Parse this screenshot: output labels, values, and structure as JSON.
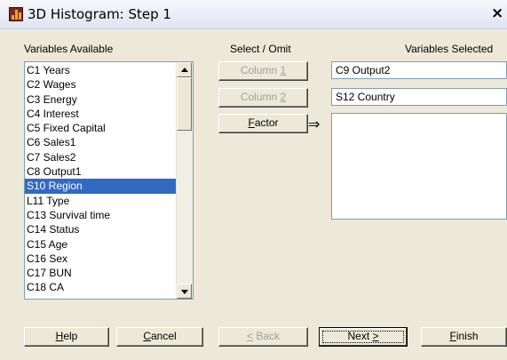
{
  "window": {
    "title": "3D Histogram: Step 1",
    "close_glyph": "×"
  },
  "labels": {
    "available": "Variables Available",
    "select_omit": "Select / Omit",
    "selected": "Variables Selected"
  },
  "variables_available": [
    "C1 Years",
    "C2 Wages",
    "C3 Energy",
    "C4 Interest",
    "C5 Fixed Capital",
    "C6 Sales1",
    "C7 Sales2",
    "C8 Output1",
    "S10 Region",
    "L11 Type",
    "C13 Survival time",
    "C14 Status",
    "C15 Age",
    "C16 Sex",
    "C17 BUN",
    "C18 CA"
  ],
  "selected_index": 8,
  "select_buttons": {
    "column1": {
      "text": "Column ",
      "key": "1"
    },
    "column2": {
      "text": "Column ",
      "key": "2"
    },
    "factor": {
      "key": "F",
      "rest": "actor"
    },
    "arrow": "⇒"
  },
  "selected_fields": {
    "column1": "C9 Output2",
    "column2": "S12 Country",
    "factor": ""
  },
  "bottom_buttons": {
    "help": {
      "key": "H",
      "rest": "elp"
    },
    "cancel": {
      "key": "C",
      "rest": "ancel"
    },
    "back": {
      "key": "<",
      "rest": " Back"
    },
    "next": {
      "text": "Next ",
      "key": ">"
    },
    "finish": {
      "key": "F",
      "rest": "inish"
    }
  }
}
